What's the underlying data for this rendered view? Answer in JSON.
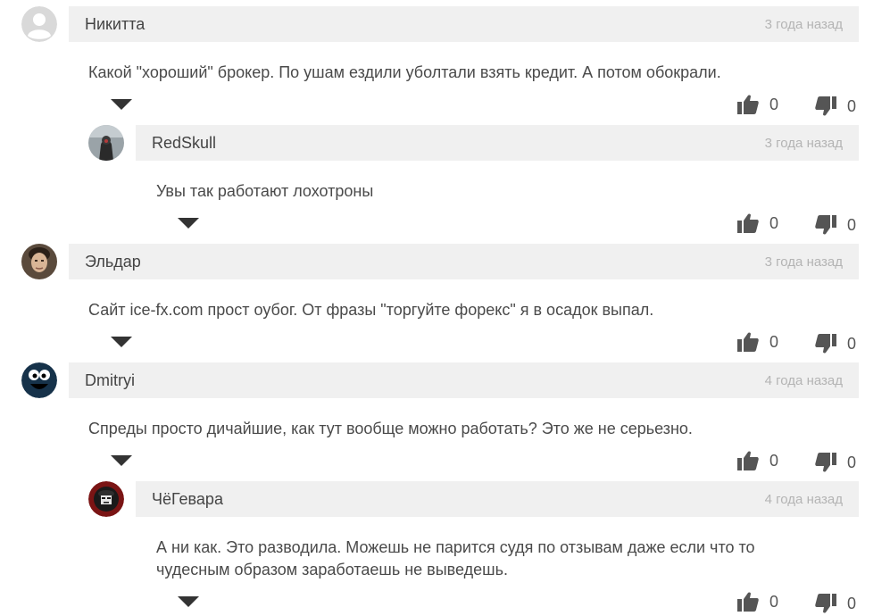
{
  "comments": [
    {
      "author": "Никитта",
      "date": "3 года назад",
      "text": "Какой \"хороший\" брокер. По ушам ездили уболтали взять кредит. А потом обокрали.",
      "likes": "0",
      "dislikes": "0"
    },
    {
      "author": "RedSkull",
      "date": "3 года назад",
      "text": "Увы так работают лохотроны",
      "likes": "0",
      "dislikes": "0"
    },
    {
      "author": "Эльдар",
      "date": "3 года назад",
      "text": "Сайт ice-fx.com прост оубог. От фразы \"торгуйте форекс\" я в осадок выпал.",
      "likes": "0",
      "dislikes": "0"
    },
    {
      "author": "Dmitryi",
      "date": "4 года назад",
      "text": "Спреды просто дичайшие, как тут вообще можно работать? Это же не серьезно.",
      "likes": "0",
      "dislikes": "0"
    },
    {
      "author": "ЧёГевара",
      "date": "4 года назад",
      "text_line1": "А ни как. Это разводила. Можешь не парится судя по отзывам даже если что то",
      "text_line2": "чудесным образом заработаешь не выведешь.",
      "likes": "0",
      "dislikes": "0"
    }
  ],
  "icons": {
    "like": "thumbs-up-icon",
    "dislike": "thumbs-down-icon",
    "collapse": "triangle-down-icon"
  },
  "colors": {
    "header_bg": "#f0f0f0",
    "date": "#b4b4b4",
    "icon": "#555555"
  }
}
